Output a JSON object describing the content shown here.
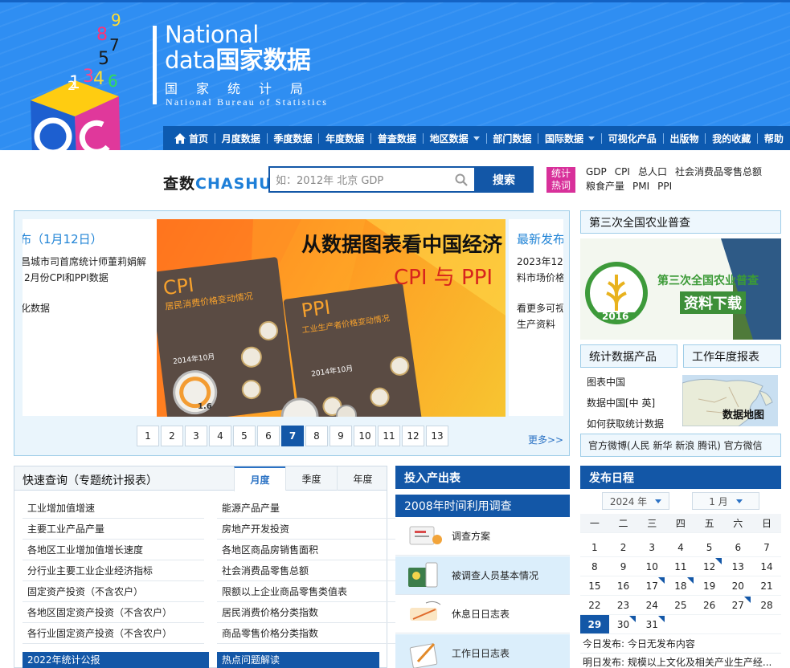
{
  "header": {
    "logo_en": "National",
    "logo_en2": "data",
    "logo_cn": "国家数据",
    "bureau_cn": "国家统计局",
    "bureau_en": "National Bureau of Statistics",
    "cube_digits": [
      "1",
      "2",
      "3",
      "4",
      "5",
      "6",
      "7",
      "8",
      "9"
    ]
  },
  "nav": {
    "items": [
      {
        "label": "首页",
        "icon": "home-icon"
      },
      {
        "label": "月度数据"
      },
      {
        "label": "季度数据"
      },
      {
        "label": "年度数据"
      },
      {
        "label": "普查数据"
      },
      {
        "label": "地区数据",
        "dropdown": true
      },
      {
        "label": "部门数据"
      },
      {
        "label": "国际数据",
        "dropdown": true
      },
      {
        "label": "可视化产品"
      },
      {
        "label": "出版物"
      },
      {
        "label": "我的收藏"
      },
      {
        "label": "帮助"
      }
    ]
  },
  "search": {
    "brand_a": "查数",
    "brand_b": "CHASHU",
    "placeholder": "如：2012年 北京 GDP",
    "button": "搜索",
    "hot_label_1": "统计",
    "hot_label_2": "热词",
    "hot_words": [
      "GDP",
      "CPI",
      "总人口",
      "社会消费品零售总额",
      "粮食产量",
      "PMI",
      "PPI"
    ]
  },
  "carousel": {
    "left_title": "布（1月12日）",
    "left_lines": [
      "昌城市司首席统计师董莉娟解",
      "2月份CPI和PPI数据",
      "",
      "化数据"
    ],
    "right_title": "最新发布",
    "right_lines": [
      "2023年12月",
      "料市场价格",
      "",
      "看更多可视",
      "生产资料"
    ],
    "banner_title": "从数据图表看中国经济",
    "banner_sub": "CPI 与 PPI",
    "card1_big": "CPI",
    "card1_title": "居民消费价格变动情况",
    "card1_date": "2014年10月",
    "card1_value": "1.6",
    "card2_big": "PPI",
    "card2_title": "工业生产者价格变动情况",
    "card2_date": "2014年10月",
    "pages": [
      "1",
      "2",
      "3",
      "4",
      "5",
      "6",
      "7",
      "8",
      "9",
      "10",
      "11",
      "12",
      "13"
    ],
    "active_page": "7",
    "more": "更多>>"
  },
  "right_panel": {
    "agri_title": "第三次全国农业普查",
    "agri_banner_1": "第三次全国农业普查",
    "agri_banner_2": "资料下载",
    "agri_year": "2016",
    "products_title": "统计数据产品",
    "yearbook_title": "工作年度报表",
    "products": [
      "图表中国",
      "数据中国[中 英]",
      "如何获取统计数据"
    ],
    "map_label": "数据地图",
    "weibo": "官方微博(人民 新华 新浪 腾讯) 官方微信"
  },
  "quick": {
    "title": "快速查询（专题统计报表）",
    "tabs": [
      "月度",
      "季度",
      "年度"
    ],
    "active_tab": "月度",
    "left": [
      "工业增加值增速",
      "主要工业产品产量",
      "各地区工业增加值增长速度",
      "分行业主要工业企业经济指标",
      "固定资产投资（不含农户）",
      "各地区固定资产投资（不含农户）",
      "各行业固定资产投资（不含农户）"
    ],
    "right": [
      "能源产品产量",
      "房地产开发投资",
      "各地区商品房销售面积",
      "社会消费品零售总额",
      "限额以上企业商品零售类值表",
      "居民消费价格分类指数",
      "商品零售价格分类指数"
    ],
    "foot_left": "2022年统计公报",
    "foot_right": "热点问题解读"
  },
  "io": {
    "title": "投入产出表",
    "survey": "2008年时间利用调查",
    "items": [
      "调查方案",
      "被调查人员基本情况",
      "休息日日志表",
      "工作日日志表"
    ]
  },
  "calendar": {
    "title": "发布日程",
    "year": "2024 年",
    "month": "1 月",
    "weekdays": [
      "一",
      "二",
      "三",
      "四",
      "五",
      "六",
      "日"
    ],
    "weeks": [
      [
        "1",
        "2",
        "3",
        "4",
        "5",
        "6",
        "7"
      ],
      [
        "8",
        "9",
        "10",
        "11",
        "12",
        "13",
        "14"
      ],
      [
        "15",
        "16",
        "17",
        "18",
        "19",
        "20",
        "21"
      ],
      [
        "22",
        "23",
        "24",
        "25",
        "26",
        "27",
        "28"
      ],
      [
        "29",
        "30",
        "31",
        "",
        "",
        "",
        ""
      ]
    ],
    "tagged": [
      "12",
      "17",
      "18",
      "27",
      "30",
      "31"
    ],
    "today": "29",
    "today_label": "今日发布:",
    "today_text": "今日无发布内容",
    "tomorrow_label": "明日发布:",
    "tomorrow_text": "规模以上文化及相关产业生产经..."
  },
  "colors": {
    "header_blue": "#2f8ef2",
    "nav_blue": "#0d5ab0",
    "accent": "#1357a7",
    "hot_pink": "#d8309a"
  }
}
